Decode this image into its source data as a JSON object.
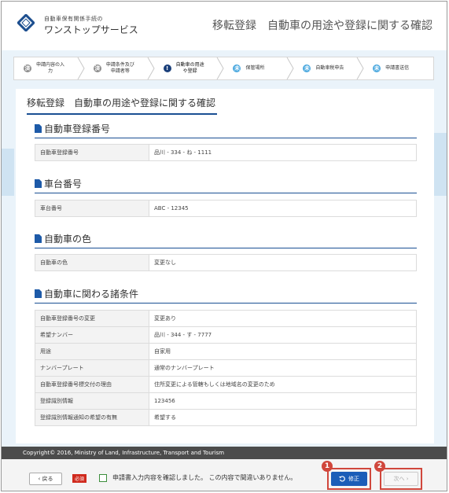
{
  "header": {
    "brand_small": "自動車保有関係手続の",
    "brand_big": "ワンストップサービス",
    "page_title": "移転登録　自動車の用途や登録に関する確認"
  },
  "steps": [
    {
      "icon": "済",
      "line1": "申請内容の入",
      "line2": "力",
      "state": "done"
    },
    {
      "icon": "済",
      "line1": "申請条件及び",
      "line2": "申請者等",
      "state": "done"
    },
    {
      "icon": "!",
      "line1": "自動車の用途",
      "line2": "や登録",
      "state": "current"
    },
    {
      "icon": "未",
      "line1": "保管場所",
      "line2": "",
      "state": "todo"
    },
    {
      "icon": "未",
      "line1": "自動車税申告",
      "line2": "",
      "state": "todo"
    },
    {
      "icon": "未",
      "line1": "申請書送信",
      "line2": "",
      "state": "todo"
    }
  ],
  "panel_title": "移転登録　自動車の用途や登録に関する確認",
  "sections": [
    {
      "title": "自動車登録番号",
      "rows": [
        {
          "k": "自動車登録番号",
          "v": "品川 - 334 - ね - 1111"
        }
      ]
    },
    {
      "title": "車台番号",
      "rows": [
        {
          "k": "車台番号",
          "v": "ABC - 12345"
        }
      ]
    },
    {
      "title": "自動車の色",
      "rows": [
        {
          "k": "自動車の色",
          "v": "変更なし"
        }
      ]
    },
    {
      "title": "自動車に関わる諸条件",
      "rows": [
        {
          "k": "自動車登録番号の変更",
          "v": "変更あり"
        },
        {
          "k": "希望ナンバー",
          "v": "品川 - 344 - す - 7777"
        },
        {
          "k": "用途",
          "v": "自家用"
        },
        {
          "k": "ナンバープレート",
          "v": "通常のナンバープレート"
        },
        {
          "k": "自動車登録番号標交付の理由",
          "v": "住所変更による管轄もしくは地域名の変更のため"
        },
        {
          "k": "登録識別情報",
          "v": "123456"
        },
        {
          "k": "登録識別情報通知の希望の有無",
          "v": "希望する"
        }
      ]
    }
  ],
  "footer": {
    "copyright": "Copyright© 2016, Ministry of Land, Infrastructure, Transport and Tourism",
    "back_label": "‹ 戻る",
    "required_label": "必須",
    "confirm_text": "申請書入力内容を確認しました。 この内容で間違いありません。",
    "fix_label": "修正",
    "next_label": "次へ ›"
  },
  "annotations": {
    "badge1": "1",
    "badge2": "2"
  },
  "colors": {
    "accent": "#1b5db8",
    "done": "#8c8c8c",
    "current": "#1a3f7a",
    "todo": "#4aa8df",
    "highlight": "#d0473c"
  }
}
